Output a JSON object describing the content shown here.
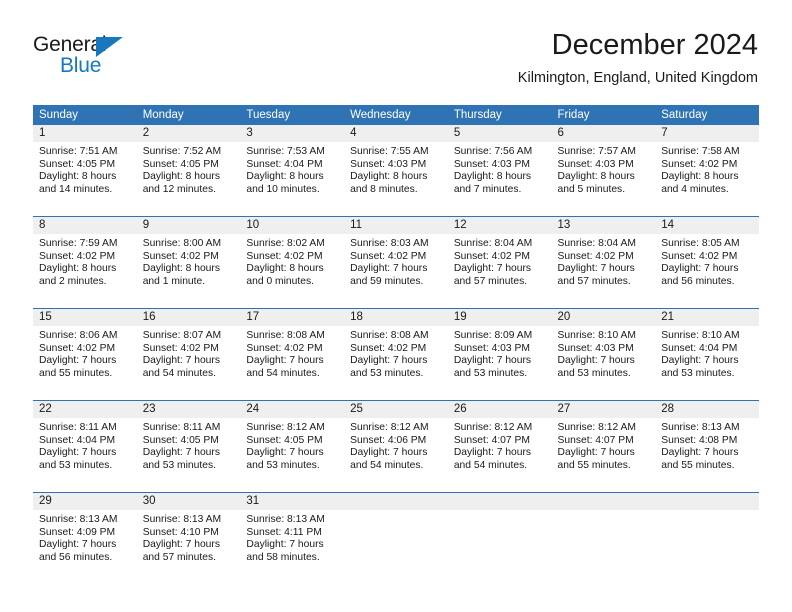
{
  "brand": {
    "name_part1": "General",
    "name_part2": "Blue",
    "accent_color": "#1878be"
  },
  "header": {
    "month_title": "December 2024",
    "location": "Kilmington, England, United Kingdom"
  },
  "calendar": {
    "header_bg": "#2f73b5",
    "daynum_bg": "#efefef",
    "weekdays": [
      "Sunday",
      "Monday",
      "Tuesday",
      "Wednesday",
      "Thursday",
      "Friday",
      "Saturday"
    ],
    "weeks": [
      {
        "days": [
          {
            "num": "1",
            "sunrise": "Sunrise: 7:51 AM",
            "sunset": "Sunset: 4:05 PM",
            "daylight1": "Daylight: 8 hours",
            "daylight2": "and 14 minutes."
          },
          {
            "num": "2",
            "sunrise": "Sunrise: 7:52 AM",
            "sunset": "Sunset: 4:05 PM",
            "daylight1": "Daylight: 8 hours",
            "daylight2": "and 12 minutes."
          },
          {
            "num": "3",
            "sunrise": "Sunrise: 7:53 AM",
            "sunset": "Sunset: 4:04 PM",
            "daylight1": "Daylight: 8 hours",
            "daylight2": "and 10 minutes."
          },
          {
            "num": "4",
            "sunrise": "Sunrise: 7:55 AM",
            "sunset": "Sunset: 4:03 PM",
            "daylight1": "Daylight: 8 hours",
            "daylight2": "and 8 minutes."
          },
          {
            "num": "5",
            "sunrise": "Sunrise: 7:56 AM",
            "sunset": "Sunset: 4:03 PM",
            "daylight1": "Daylight: 8 hours",
            "daylight2": "and 7 minutes."
          },
          {
            "num": "6",
            "sunrise": "Sunrise: 7:57 AM",
            "sunset": "Sunset: 4:03 PM",
            "daylight1": "Daylight: 8 hours",
            "daylight2": "and 5 minutes."
          },
          {
            "num": "7",
            "sunrise": "Sunrise: 7:58 AM",
            "sunset": "Sunset: 4:02 PM",
            "daylight1": "Daylight: 8 hours",
            "daylight2": "and 4 minutes."
          }
        ]
      },
      {
        "days": [
          {
            "num": "8",
            "sunrise": "Sunrise: 7:59 AM",
            "sunset": "Sunset: 4:02 PM",
            "daylight1": "Daylight: 8 hours",
            "daylight2": "and 2 minutes."
          },
          {
            "num": "9",
            "sunrise": "Sunrise: 8:00 AM",
            "sunset": "Sunset: 4:02 PM",
            "daylight1": "Daylight: 8 hours",
            "daylight2": "and 1 minute."
          },
          {
            "num": "10",
            "sunrise": "Sunrise: 8:02 AM",
            "sunset": "Sunset: 4:02 PM",
            "daylight1": "Daylight: 8 hours",
            "daylight2": "and 0 minutes."
          },
          {
            "num": "11",
            "sunrise": "Sunrise: 8:03 AM",
            "sunset": "Sunset: 4:02 PM",
            "daylight1": "Daylight: 7 hours",
            "daylight2": "and 59 minutes."
          },
          {
            "num": "12",
            "sunrise": "Sunrise: 8:04 AM",
            "sunset": "Sunset: 4:02 PM",
            "daylight1": "Daylight: 7 hours",
            "daylight2": "and 57 minutes."
          },
          {
            "num": "13",
            "sunrise": "Sunrise: 8:04 AM",
            "sunset": "Sunset: 4:02 PM",
            "daylight1": "Daylight: 7 hours",
            "daylight2": "and 57 minutes."
          },
          {
            "num": "14",
            "sunrise": "Sunrise: 8:05 AM",
            "sunset": "Sunset: 4:02 PM",
            "daylight1": "Daylight: 7 hours",
            "daylight2": "and 56 minutes."
          }
        ]
      },
      {
        "days": [
          {
            "num": "15",
            "sunrise": "Sunrise: 8:06 AM",
            "sunset": "Sunset: 4:02 PM",
            "daylight1": "Daylight: 7 hours",
            "daylight2": "and 55 minutes."
          },
          {
            "num": "16",
            "sunrise": "Sunrise: 8:07 AM",
            "sunset": "Sunset: 4:02 PM",
            "daylight1": "Daylight: 7 hours",
            "daylight2": "and 54 minutes."
          },
          {
            "num": "17",
            "sunrise": "Sunrise: 8:08 AM",
            "sunset": "Sunset: 4:02 PM",
            "daylight1": "Daylight: 7 hours",
            "daylight2": "and 54 minutes."
          },
          {
            "num": "18",
            "sunrise": "Sunrise: 8:08 AM",
            "sunset": "Sunset: 4:02 PM",
            "daylight1": "Daylight: 7 hours",
            "daylight2": "and 53 minutes."
          },
          {
            "num": "19",
            "sunrise": "Sunrise: 8:09 AM",
            "sunset": "Sunset: 4:03 PM",
            "daylight1": "Daylight: 7 hours",
            "daylight2": "and 53 minutes."
          },
          {
            "num": "20",
            "sunrise": "Sunrise: 8:10 AM",
            "sunset": "Sunset: 4:03 PM",
            "daylight1": "Daylight: 7 hours",
            "daylight2": "and 53 minutes."
          },
          {
            "num": "21",
            "sunrise": "Sunrise: 8:10 AM",
            "sunset": "Sunset: 4:04 PM",
            "daylight1": "Daylight: 7 hours",
            "daylight2": "and 53 minutes."
          }
        ]
      },
      {
        "days": [
          {
            "num": "22",
            "sunrise": "Sunrise: 8:11 AM",
            "sunset": "Sunset: 4:04 PM",
            "daylight1": "Daylight: 7 hours",
            "daylight2": "and 53 minutes."
          },
          {
            "num": "23",
            "sunrise": "Sunrise: 8:11 AM",
            "sunset": "Sunset: 4:05 PM",
            "daylight1": "Daylight: 7 hours",
            "daylight2": "and 53 minutes."
          },
          {
            "num": "24",
            "sunrise": "Sunrise: 8:12 AM",
            "sunset": "Sunset: 4:05 PM",
            "daylight1": "Daylight: 7 hours",
            "daylight2": "and 53 minutes."
          },
          {
            "num": "25",
            "sunrise": "Sunrise: 8:12 AM",
            "sunset": "Sunset: 4:06 PM",
            "daylight1": "Daylight: 7 hours",
            "daylight2": "and 54 minutes."
          },
          {
            "num": "26",
            "sunrise": "Sunrise: 8:12 AM",
            "sunset": "Sunset: 4:07 PM",
            "daylight1": "Daylight: 7 hours",
            "daylight2": "and 54 minutes."
          },
          {
            "num": "27",
            "sunrise": "Sunrise: 8:12 AM",
            "sunset": "Sunset: 4:07 PM",
            "daylight1": "Daylight: 7 hours",
            "daylight2": "and 55 minutes."
          },
          {
            "num": "28",
            "sunrise": "Sunrise: 8:13 AM",
            "sunset": "Sunset: 4:08 PM",
            "daylight1": "Daylight: 7 hours",
            "daylight2": "and 55 minutes."
          }
        ]
      },
      {
        "days": [
          {
            "num": "29",
            "sunrise": "Sunrise: 8:13 AM",
            "sunset": "Sunset: 4:09 PM",
            "daylight1": "Daylight: 7 hours",
            "daylight2": "and 56 minutes."
          },
          {
            "num": "30",
            "sunrise": "Sunrise: 8:13 AM",
            "sunset": "Sunset: 4:10 PM",
            "daylight1": "Daylight: 7 hours",
            "daylight2": "and 57 minutes."
          },
          {
            "num": "31",
            "sunrise": "Sunrise: 8:13 AM",
            "sunset": "Sunset: 4:11 PM",
            "daylight1": "Daylight: 7 hours",
            "daylight2": "and 58 minutes."
          },
          {
            "num": "",
            "sunrise": "",
            "sunset": "",
            "daylight1": "",
            "daylight2": ""
          },
          {
            "num": "",
            "sunrise": "",
            "sunset": "",
            "daylight1": "",
            "daylight2": ""
          },
          {
            "num": "",
            "sunrise": "",
            "sunset": "",
            "daylight1": "",
            "daylight2": ""
          },
          {
            "num": "",
            "sunrise": "",
            "sunset": "",
            "daylight1": "",
            "daylight2": ""
          }
        ]
      }
    ]
  }
}
